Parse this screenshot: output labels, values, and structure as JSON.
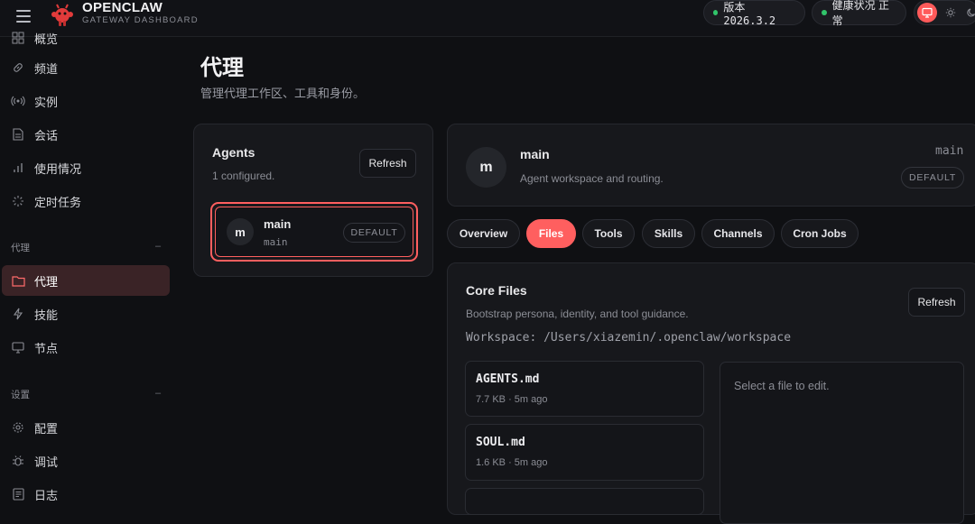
{
  "brand": {
    "title": "OPENCLAW",
    "subtitle": "GATEWAY DASHBOARD"
  },
  "status": {
    "version": "版本 2026.3.2",
    "health": "健康状况 正常"
  },
  "sidebar": {
    "items_top": [
      {
        "label": "概览",
        "icon": "dashboard-icon"
      },
      {
        "label": "频道",
        "icon": "link-icon"
      },
      {
        "label": "实例",
        "icon": "broadcast-icon"
      },
      {
        "label": "会话",
        "icon": "document-icon"
      },
      {
        "label": "使用情况",
        "icon": "bar-chart-icon"
      },
      {
        "label": "定时任务",
        "icon": "loader-icon"
      }
    ],
    "group_agent": "代理",
    "items_agent": [
      {
        "label": "代理",
        "icon": "folder-icon"
      },
      {
        "label": "技能",
        "icon": "lightning-icon"
      },
      {
        "label": "节点",
        "icon": "monitor-icon"
      }
    ],
    "group_settings": "设置",
    "items_settings": [
      {
        "label": "配置",
        "icon": "gear-icon"
      },
      {
        "label": "调试",
        "icon": "bug-icon"
      },
      {
        "label": "日志",
        "icon": "log-icon"
      }
    ],
    "collapse_symbol": "–"
  },
  "page": {
    "title": "代理",
    "subtitle": "管理代理工作区、工具和身份。"
  },
  "agents_panel": {
    "title": "Agents",
    "count": "1 configured.",
    "refresh": "Refresh",
    "agent": {
      "initial": "m",
      "name": "main",
      "id": "main",
      "badge": "DEFAULT"
    }
  },
  "agent_header": {
    "initial": "m",
    "name": "main",
    "description": "Agent workspace and routing.",
    "id": "main",
    "badge": "DEFAULT"
  },
  "tabs": [
    "Overview",
    "Files",
    "Tools",
    "Skills",
    "Channels",
    "Cron Jobs"
  ],
  "active_tab": "Files",
  "core_files": {
    "title": "Core Files",
    "subtitle": "Bootstrap persona, identity, and tool guidance.",
    "workspace": "Workspace: /Users/xiazemin/.openclaw/workspace",
    "refresh": "Refresh",
    "files": [
      {
        "name": "AGENTS.md",
        "meta": "7.7 KB · 5m ago"
      },
      {
        "name": "SOUL.md",
        "meta": "1.6 KB · 5m ago"
      }
    ],
    "editor_placeholder": "Select a file to edit."
  },
  "colors": {
    "accent": "#ff5f5f",
    "ok": "#31c46a",
    "bg": "#0f1013",
    "card": "#17181c"
  }
}
